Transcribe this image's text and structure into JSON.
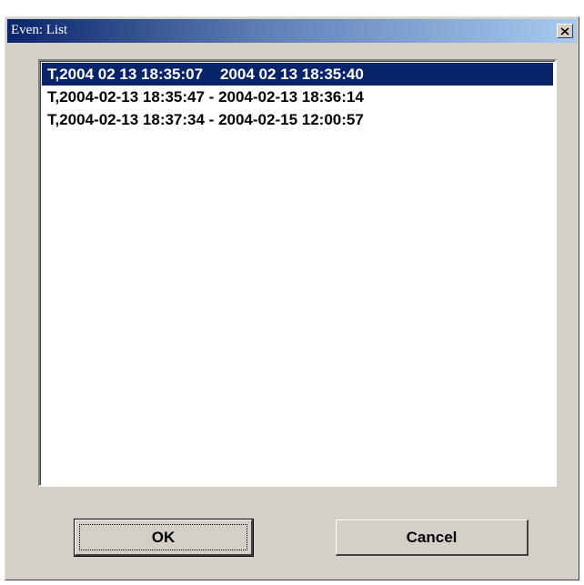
{
  "window": {
    "title": "Even: List"
  },
  "close_button": {
    "glyph": "×",
    "icon": "close-icon"
  },
  "event_list": {
    "items": [
      {
        "label": "T,2004 02 13 18:35:07    2004 02 13 18:35:40",
        "selected": true
      },
      {
        "label": "T,2004-02-13 18:35:47 - 2004-02-13 18:36:14",
        "selected": false
      },
      {
        "label": "T,2004-02-13 18:37:34 - 2004-02-15 12:00:57",
        "selected": false
      }
    ]
  },
  "buttons": {
    "ok_label": "OK",
    "cancel_label": "Cancel"
  },
  "colors": {
    "selection": "#0a246a",
    "title_gradient_start": "#0a246a",
    "title_gradient_end": "#a6caf0",
    "face": "#d4d0c8"
  }
}
